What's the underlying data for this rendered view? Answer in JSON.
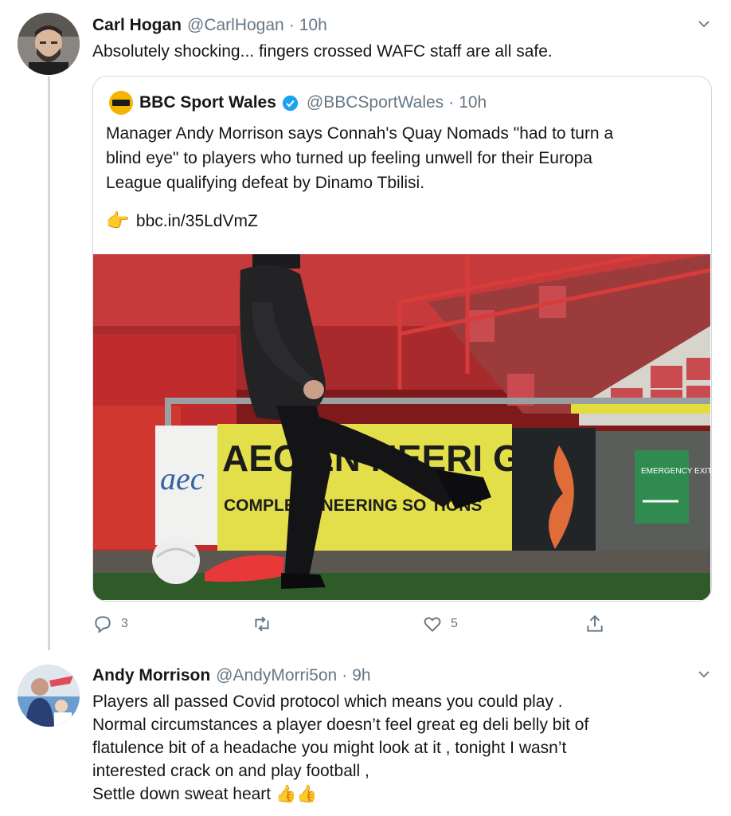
{
  "tweets": [
    {
      "name": "Carl Hogan",
      "handle": "@CarlHogan",
      "time": "10h",
      "text": "Absolutely shocking... fingers crossed WAFC staff are all safe.",
      "quote": {
        "name": "BBC Sport Wales",
        "handle": "@BBCSportWales",
        "time": "10h",
        "text_lines": [
          "Manager Andy Morrison says Connah's Quay Nomads \"had to turn a",
          "blind eye\" to players who turned up feeling unwell for their Europa",
          "League qualifying defeat by Dinamo Tbilisi."
        ],
        "link": "bbc.in/35LdVmZ",
        "image": {
          "hoarding_main": "AEC EN   NEERI  G LTD",
          "hoarding_sub": "COMPLETE     NEERING SO   TIONS",
          "logo": "aec",
          "exit_sign": "EMERGENCY EXIT"
        }
      },
      "actions": {
        "replies": "3",
        "retweets": "",
        "likes": "5"
      }
    },
    {
      "name": "Andy Morrison",
      "handle": "@AndyMorri5on",
      "time": "9h",
      "text_lines": [
        "Players all passed  Covid protocol which means you could play .",
        "Normal circumstances a player doesn’t feel great eg deli belly bit of",
        "flatulence bit of a headache you might look at it , tonight  I wasn’t",
        "interested crack on and play football ,",
        "Settle down sweat heart 👍👍"
      ]
    }
  ],
  "icons": {
    "chevron": "chevron-down-icon",
    "verified": "verified-badge-icon",
    "reply": "reply-icon",
    "retweet": "retweet-icon",
    "like": "heart-icon",
    "share": "share-icon",
    "link_pointer": "pointing-hand-icon"
  },
  "colors": {
    "secondary_text": "#657786",
    "border": "#cfd9de",
    "verified": "#1da1f2",
    "hoarding_yellow": "#e4e24a",
    "stand_red": "#b32024"
  }
}
